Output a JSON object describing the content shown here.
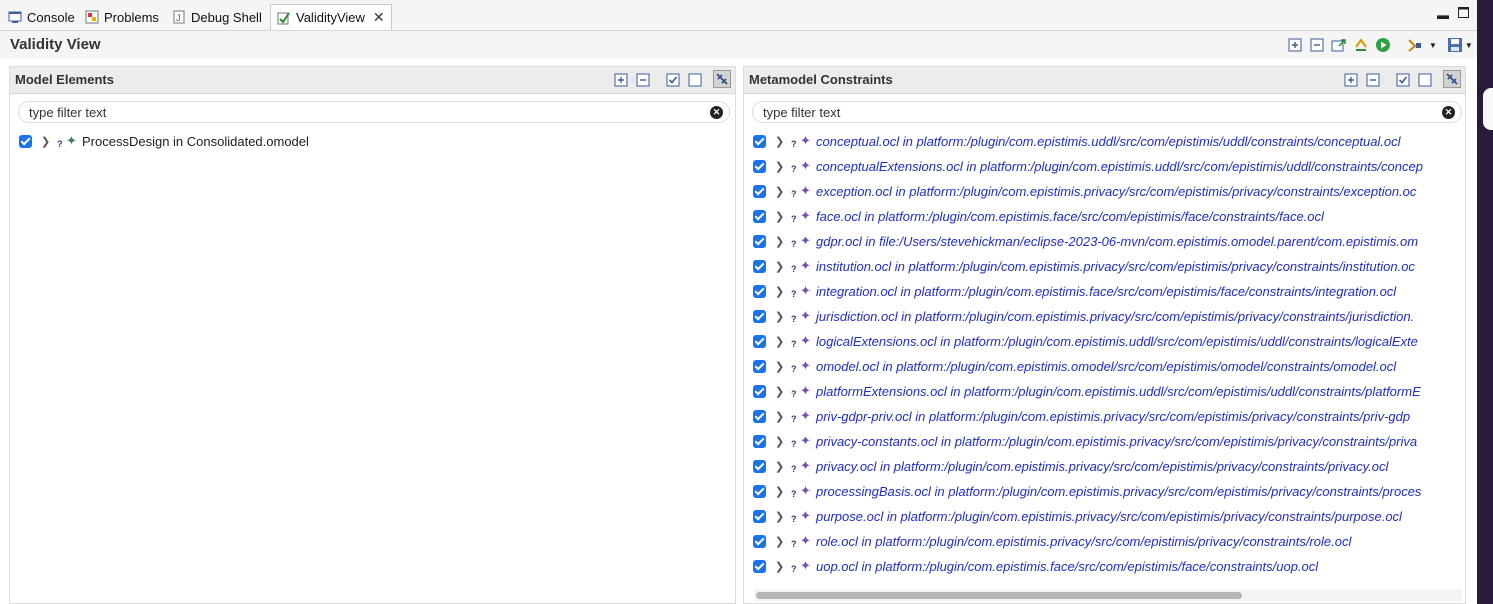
{
  "tabs": [
    {
      "label": "Console",
      "icon": "console-icon"
    },
    {
      "label": "Problems",
      "icon": "problems-icon"
    },
    {
      "label": "Debug Shell",
      "icon": "debug-shell-icon"
    },
    {
      "label": "ValidityView",
      "icon": "validity-view-icon",
      "active": true
    }
  ],
  "view": {
    "title": "Validity View"
  },
  "left_panel": {
    "title": "Model Elements",
    "filter_placeholder": "type filter text",
    "items": [
      {
        "label": "ProcessDesign in Consolidated.omodel",
        "checked": true
      }
    ]
  },
  "right_panel": {
    "title": "Metamodel Constraints",
    "filter_placeholder": "type filter text",
    "items": [
      {
        "label": "conceptual.ocl in platform:/plugin/com.epistimis.uddl/src/com/epistimis/uddl/constraints/conceptual.ocl",
        "checked": true
      },
      {
        "label": "conceptualExtensions.ocl in platform:/plugin/com.epistimis.uddl/src/com/epistimis/uddl/constraints/concep",
        "checked": true
      },
      {
        "label": "exception.ocl in platform:/plugin/com.epistimis.privacy/src/com/epistimis/privacy/constraints/exception.oc",
        "checked": true
      },
      {
        "label": "face.ocl in platform:/plugin/com.epistimis.face/src/com/epistimis/face/constraints/face.ocl",
        "checked": true
      },
      {
        "label": "gdpr.ocl in file:/Users/stevehickman/eclipse-2023-06-mvn/com.epistimis.omodel.parent/com.epistimis.om",
        "checked": true
      },
      {
        "label": "institution.ocl in platform:/plugin/com.epistimis.privacy/src/com/epistimis/privacy/constraints/institution.oc",
        "checked": true
      },
      {
        "label": "integration.ocl in platform:/plugin/com.epistimis.face/src/com/epistimis/face/constraints/integration.ocl",
        "checked": true
      },
      {
        "label": "jurisdiction.ocl in platform:/plugin/com.epistimis.privacy/src/com/epistimis/privacy/constraints/jurisdiction.",
        "checked": true
      },
      {
        "label": "logicalExtensions.ocl in platform:/plugin/com.epistimis.uddl/src/com/epistimis/uddl/constraints/logicalExte",
        "checked": true
      },
      {
        "label": "omodel.ocl in platform:/plugin/com.epistimis.omodel/src/com/epistimis/omodel/constraints/omodel.ocl",
        "checked": true
      },
      {
        "label": "platformExtensions.ocl in platform:/plugin/com.epistimis.uddl/src/com/epistimis/uddl/constraints/platformE",
        "checked": true
      },
      {
        "label": "priv-gdpr-priv.ocl in platform:/plugin/com.epistimis.privacy/src/com/epistimis/privacy/constraints/priv-gdp",
        "checked": true
      },
      {
        "label": "privacy-constants.ocl in platform:/plugin/com.epistimis.privacy/src/com/epistimis/privacy/constraints/priva",
        "checked": true
      },
      {
        "label": "privacy.ocl in platform:/plugin/com.epistimis.privacy/src/com/epistimis/privacy/constraints/privacy.ocl",
        "checked": true
      },
      {
        "label": "processingBasis.ocl in platform:/plugin/com.epistimis.privacy/src/com/epistimis/privacy/constraints/proces",
        "checked": true
      },
      {
        "label": "purpose.ocl in platform:/plugin/com.epistimis.privacy/src/com/epistimis/privacy/constraints/purpose.ocl",
        "checked": true
      },
      {
        "label": "role.ocl in platform:/plugin/com.epistimis.privacy/src/com/epistimis/privacy/constraints/role.ocl",
        "checked": true
      },
      {
        "label": "uop.ocl in platform:/plugin/com.epistimis.face/src/com/epistimis/face/constraints/uop.ocl",
        "checked": true
      }
    ]
  },
  "colors": {
    "checkbox": "#1a73e8",
    "constraint_text": "#1f2ec6",
    "element_icon": "#3a7d5a",
    "constraint_icon": "#7a4fb0"
  }
}
